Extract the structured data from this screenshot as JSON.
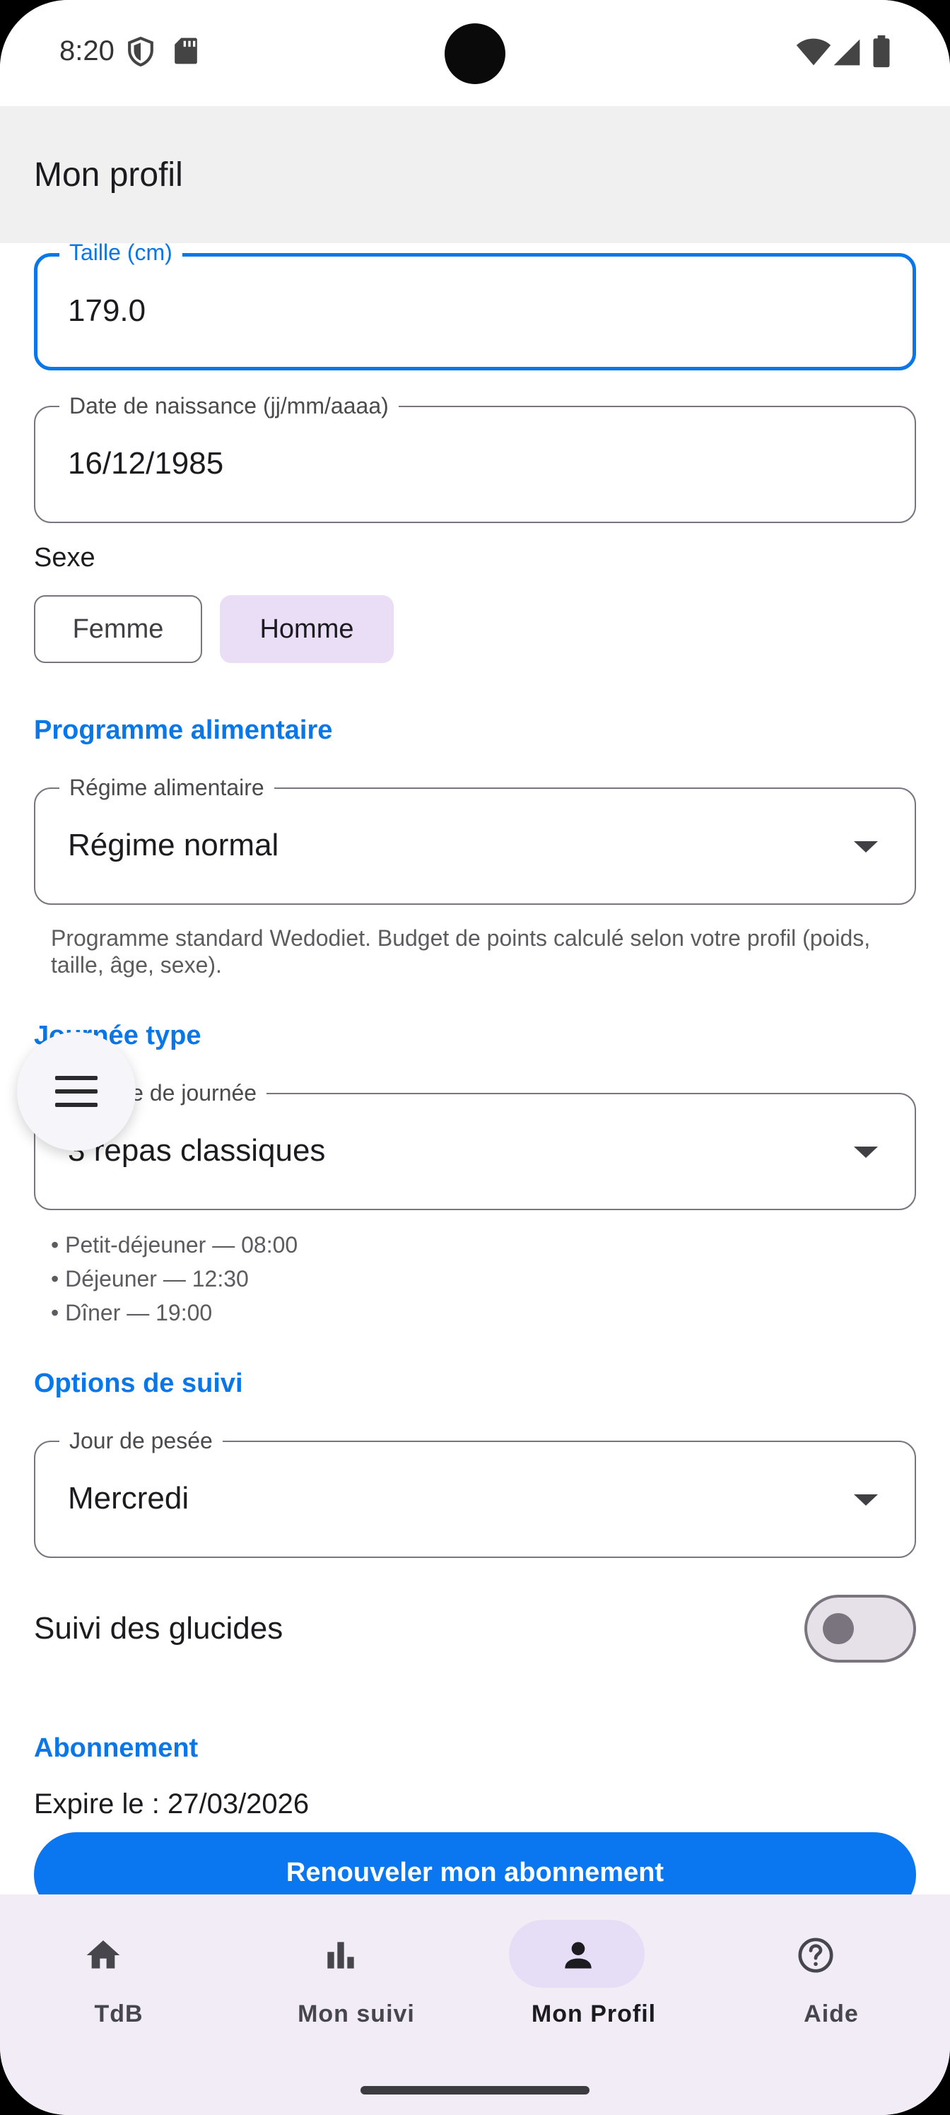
{
  "status_bar": {
    "time": "8:20"
  },
  "app_bar": {
    "title": "Mon profil"
  },
  "profile": {
    "height_field": {
      "label": "Taille (cm)",
      "value": "179.0"
    },
    "birthdate_field": {
      "label": "Date de naissance (jj/mm/aaaa)",
      "value": "16/12/1985"
    },
    "sex": {
      "label": "Sexe",
      "options": [
        "Femme",
        "Homme"
      ],
      "selected": "Homme"
    }
  },
  "diet_program": {
    "section_title": "Programme alimentaire",
    "diet_field": {
      "label": "Régime alimentaire",
      "value": "Régime normal"
    },
    "helper": "Programme standard Wedodiet. Budget de points calculé selon votre profil (poids, taille, âge, sexe)."
  },
  "typical_day": {
    "section_title": "Journée type",
    "template_field": {
      "label": "Modèle de journée",
      "value": "3 repas classiques"
    },
    "meals": [
      "• Petit-déjeuner — 08:00",
      "• Déjeuner — 12:30",
      "• Dîner — 19:00"
    ]
  },
  "tracking_options": {
    "section_title": "Options de suivi",
    "weigh_day_field": {
      "label": "Jour de pesée",
      "value": "Mercredi"
    },
    "carbs_tracking": {
      "label": "Suivi des glucides",
      "enabled": false
    }
  },
  "subscription": {
    "section_title": "Abonnement",
    "expiry": "Expire le : 27/03/2026",
    "renew_button": "Renouveler mon abonnement"
  },
  "bottom_nav": {
    "items": [
      {
        "label": "TdB",
        "icon": "home-icon",
        "active": false
      },
      {
        "label": "Mon suivi",
        "icon": "bar-chart-icon",
        "active": false
      },
      {
        "label": "Mon Profil",
        "icon": "person-icon",
        "active": true
      },
      {
        "label": "Aide",
        "icon": "help-circle-icon",
        "active": false
      }
    ]
  },
  "colors": {
    "accent": "#0a77e8",
    "chip_selected": "#e9def6",
    "nav_background": "#f2ecf7"
  }
}
